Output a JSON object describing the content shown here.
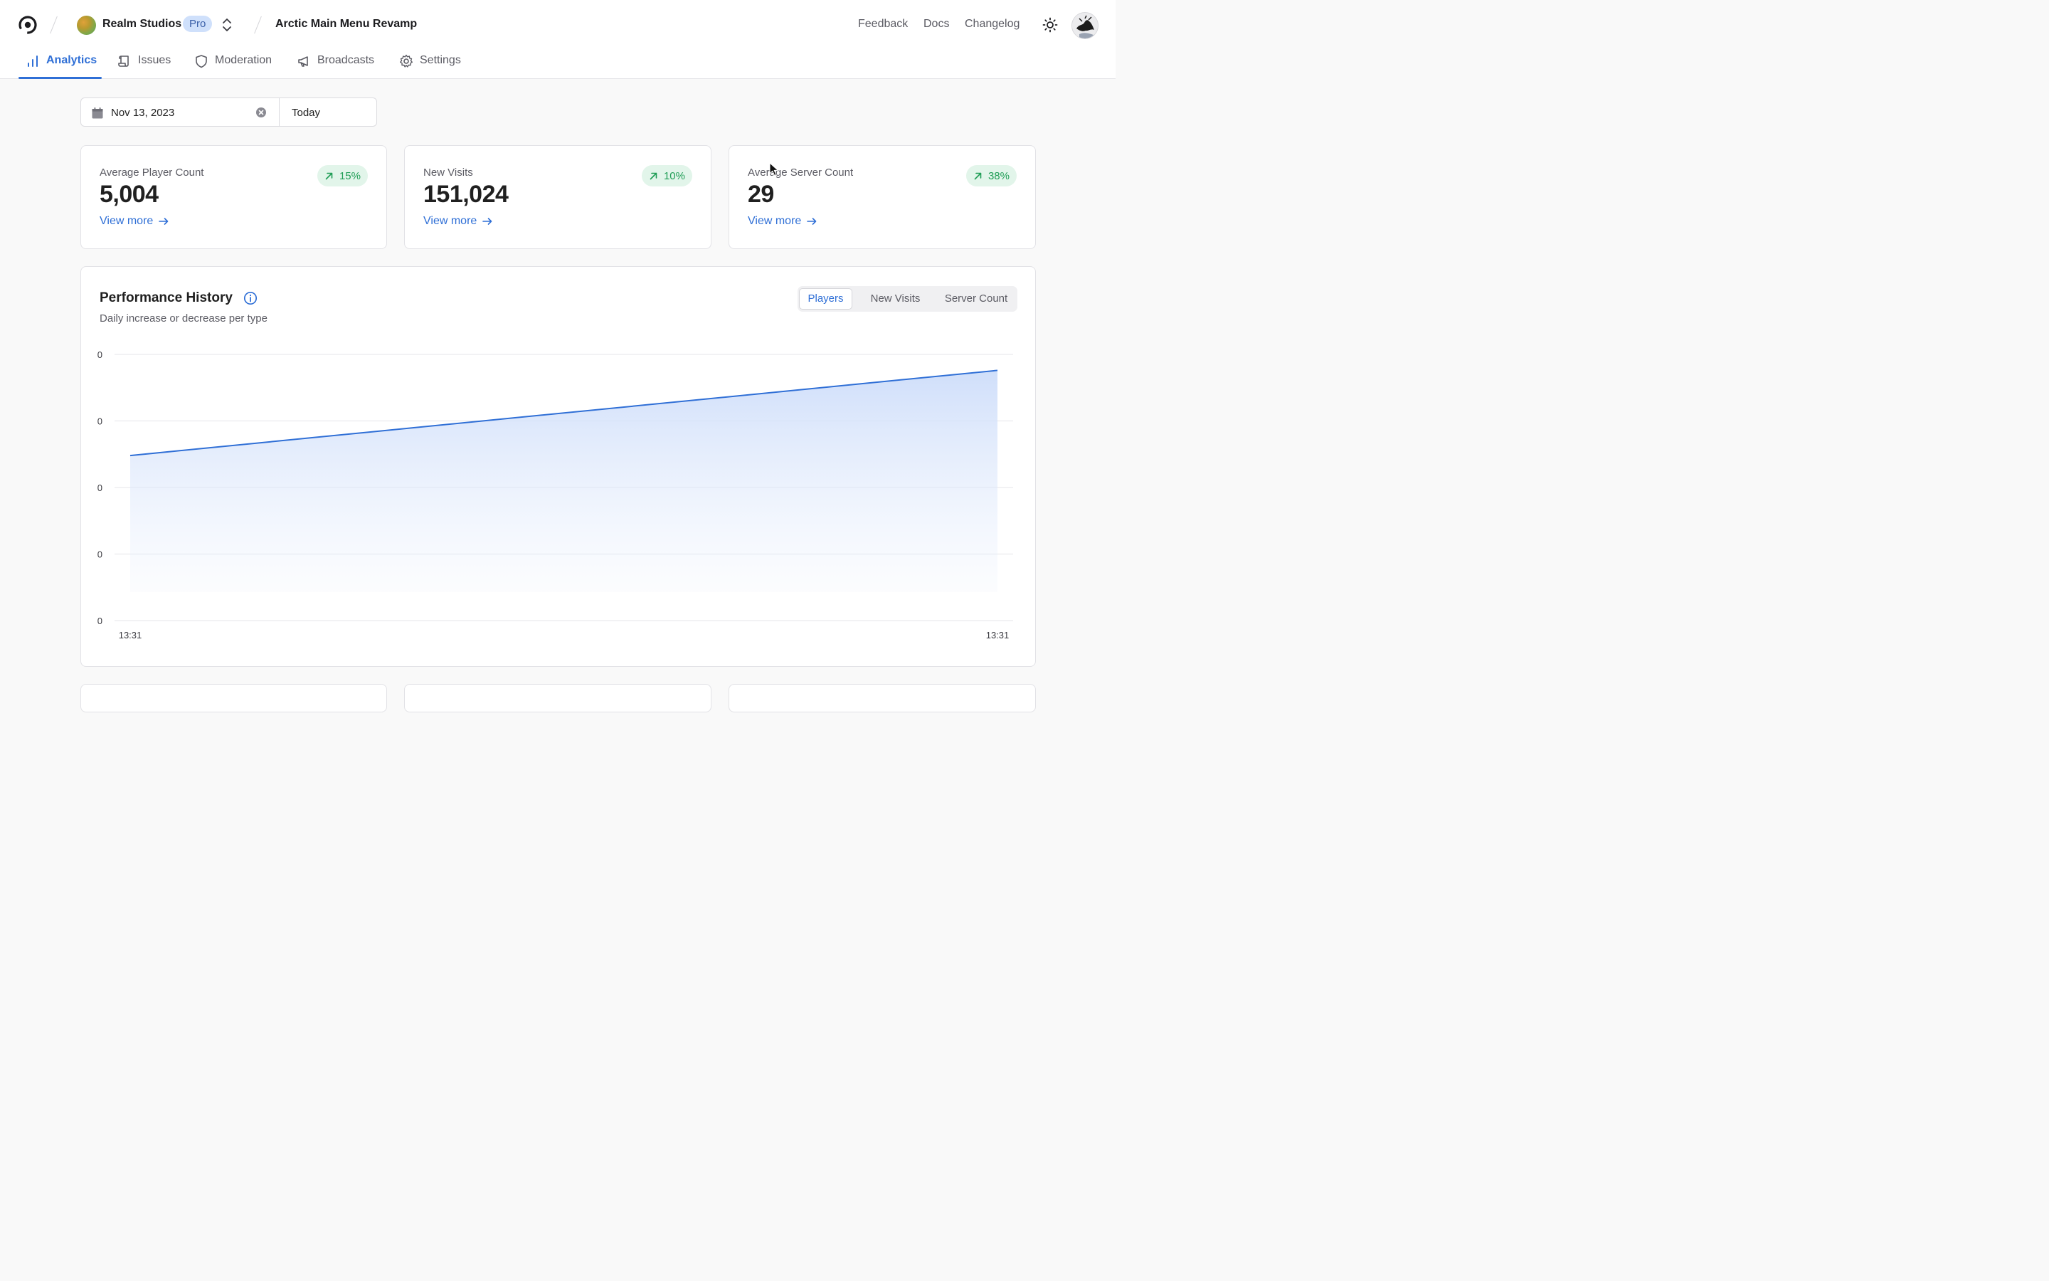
{
  "header": {
    "org_name": "Realm Studios",
    "plan_badge": "Pro",
    "project_name": "Arctic Main Menu Revamp",
    "links": [
      "Feedback",
      "Docs",
      "Changelog"
    ]
  },
  "tabs": [
    {
      "label": "Analytics",
      "icon": "bar-chart-icon",
      "active": true
    },
    {
      "label": "Issues",
      "icon": "scroll-icon",
      "active": false
    },
    {
      "label": "Moderation",
      "icon": "shield-icon",
      "active": false
    },
    {
      "label": "Broadcasts",
      "icon": "megaphone-icon",
      "active": false
    },
    {
      "label": "Settings",
      "icon": "gear-icon",
      "active": false
    }
  ],
  "date_filter": {
    "start": "Nov 13, 2023",
    "end": "Today"
  },
  "stats": [
    {
      "label": "Average Player Count",
      "value": "5,004",
      "trend": "15%",
      "link": "View more"
    },
    {
      "label": "New Visits",
      "value": "151,024",
      "trend": "10%",
      "link": "View more"
    },
    {
      "label": "Average Server Count",
      "value": "29",
      "trend": "38%",
      "link": "View more"
    }
  ],
  "performance": {
    "title": "Performance History",
    "subtitle": "Daily increase or decrease per type",
    "toggles": [
      "Players",
      "New Visits",
      "Server Count"
    ],
    "active_toggle": "Players"
  },
  "colors": {
    "accent": "#2f6fd6",
    "trend_up": "#1f9d55",
    "trend_bg": "#e2f5ea"
  },
  "chart_data": {
    "type": "area",
    "x": [
      "13:31",
      "13:31"
    ],
    "y_tick_labels": [
      "0",
      "0",
      "0",
      "0",
      "0"
    ],
    "series": [
      {
        "values": [
          0.62,
          0.94
        ]
      }
    ],
    "ylim": [
      0,
      1
    ],
    "grid": true
  }
}
